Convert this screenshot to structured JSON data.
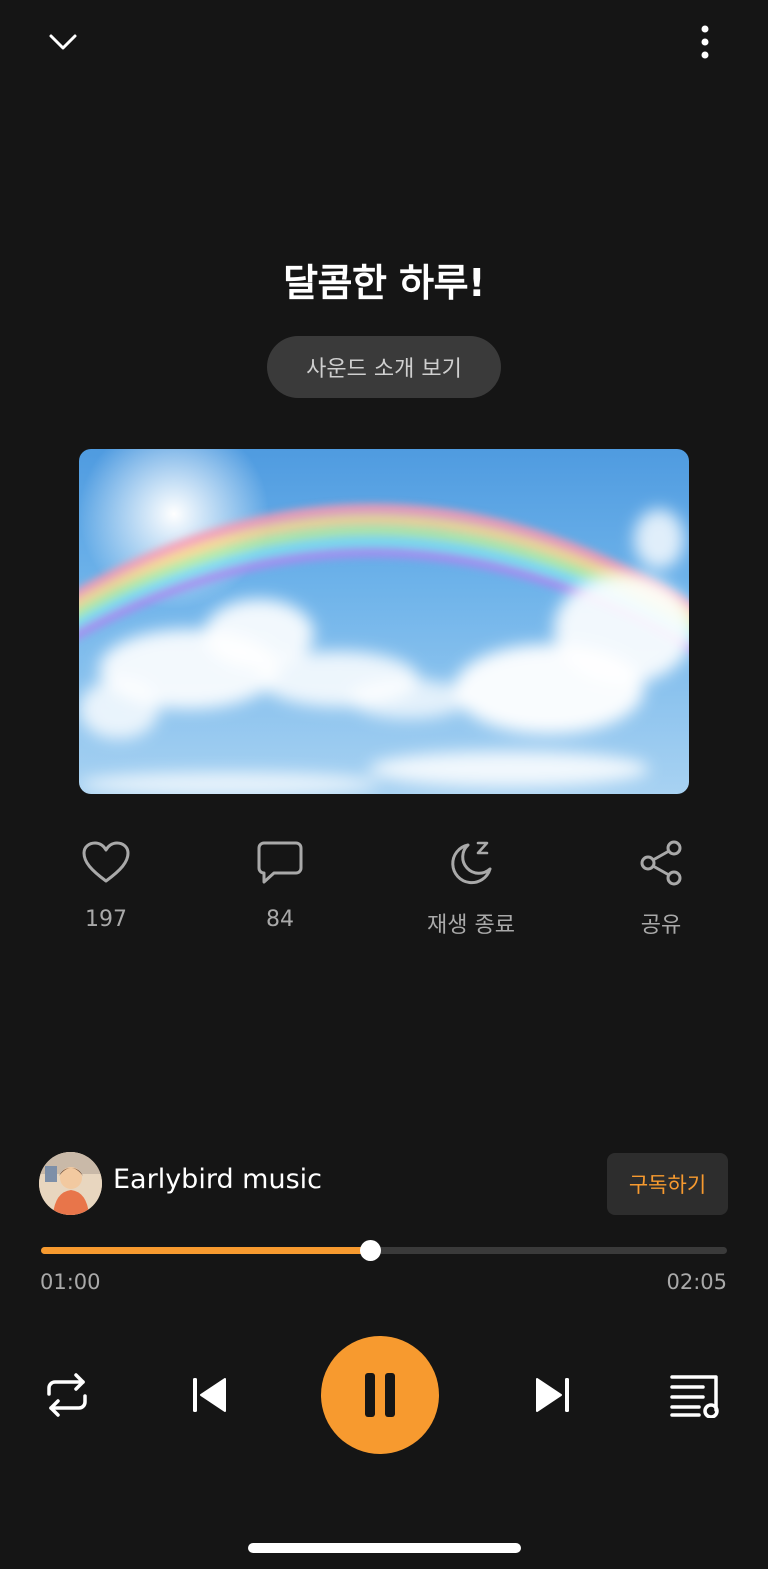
{
  "header": {
    "collapse_icon": "chevron-down-icon",
    "more_icon": "more-vertical-icon"
  },
  "track": {
    "title": "달콤한 하루!",
    "intro_button": "사운드 소개 보기",
    "artwork": "rainbow-sky-image"
  },
  "actions": {
    "like": {
      "icon": "heart-icon",
      "label": "197"
    },
    "comment": {
      "icon": "comment-icon",
      "label": "84"
    },
    "sleep_timer": {
      "icon": "moon-sleep-icon",
      "label": "재생 종료"
    },
    "share": {
      "icon": "share-icon",
      "label": "공유"
    }
  },
  "channel": {
    "name": "Earlybird music",
    "subscribe_label": "구독하기"
  },
  "progress": {
    "elapsed": "01:00",
    "duration": "02:05",
    "fraction": 0.48
  },
  "controls": {
    "repeat_icon": "repeat-icon",
    "previous_icon": "skip-previous-icon",
    "pause_icon": "pause-icon",
    "next_icon": "skip-next-icon",
    "playlist_icon": "playlist-icon"
  },
  "colors": {
    "accent": "#f79a2f",
    "background": "#151515",
    "muted_text": "#a9a9a9"
  }
}
